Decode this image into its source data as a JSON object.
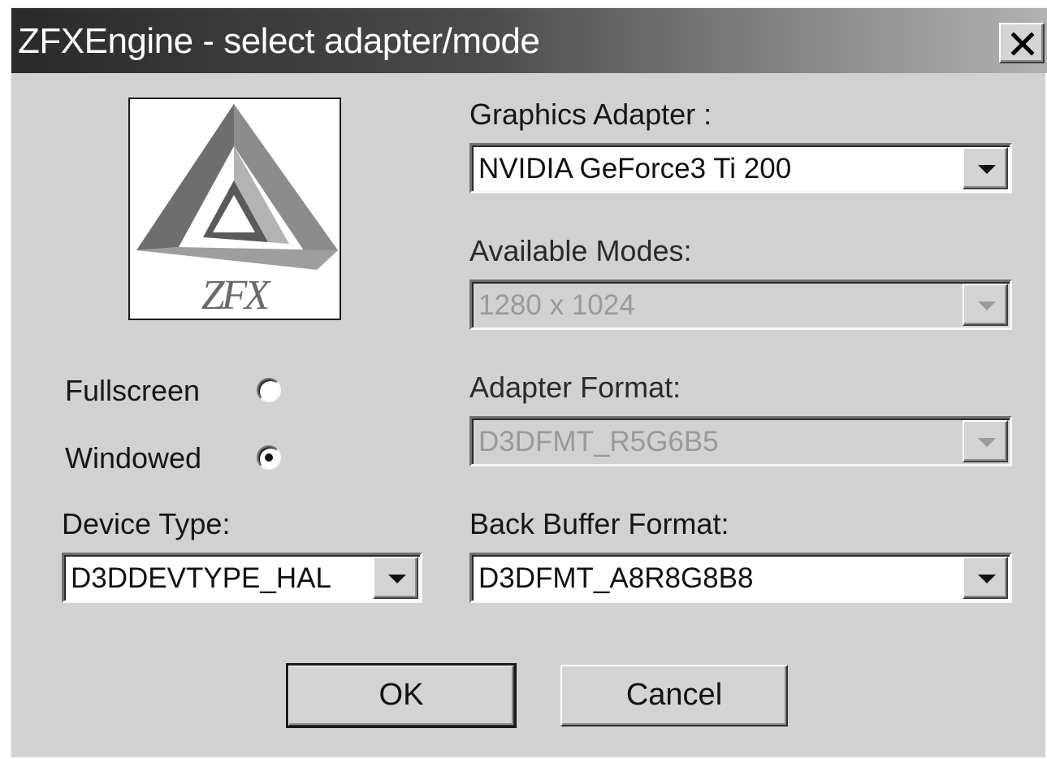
{
  "window": {
    "title": "ZFXEngine - select adapter/mode",
    "close_label": "close"
  },
  "logo": {
    "text": "ZFX"
  },
  "display_mode": {
    "fullscreen_label": "Fullscreen",
    "windowed_label": "Windowed",
    "selected": "Windowed"
  },
  "device_type": {
    "label": "Device Type:",
    "value": "D3DDEVTYPE_HAL"
  },
  "graphics_adapter": {
    "label": "Graphics Adapter :",
    "value": "NVIDIA GeForce3 Ti 200"
  },
  "available_modes": {
    "label": "Available Modes:",
    "value": "1280 x 1024",
    "enabled": false
  },
  "adapter_format": {
    "label": "Adapter Format:",
    "value": "D3DFMT_R5G6B5",
    "enabled": false
  },
  "back_buffer_format": {
    "label": "Back Buffer Format:",
    "value": "D3DFMT_A8R8G8B8"
  },
  "buttons": {
    "ok": "OK",
    "cancel": "Cancel"
  },
  "icons": {
    "close": "close-icon",
    "dropdown": "chevron-down-icon",
    "logo": "zfx-logo-icon"
  },
  "colors": {
    "dialog_bg": "#d2d2d2",
    "titlebar_dark": "#2a2a2a",
    "titlebar_light": "#b2b2b2",
    "disabled_text": "#9a9a9a"
  }
}
